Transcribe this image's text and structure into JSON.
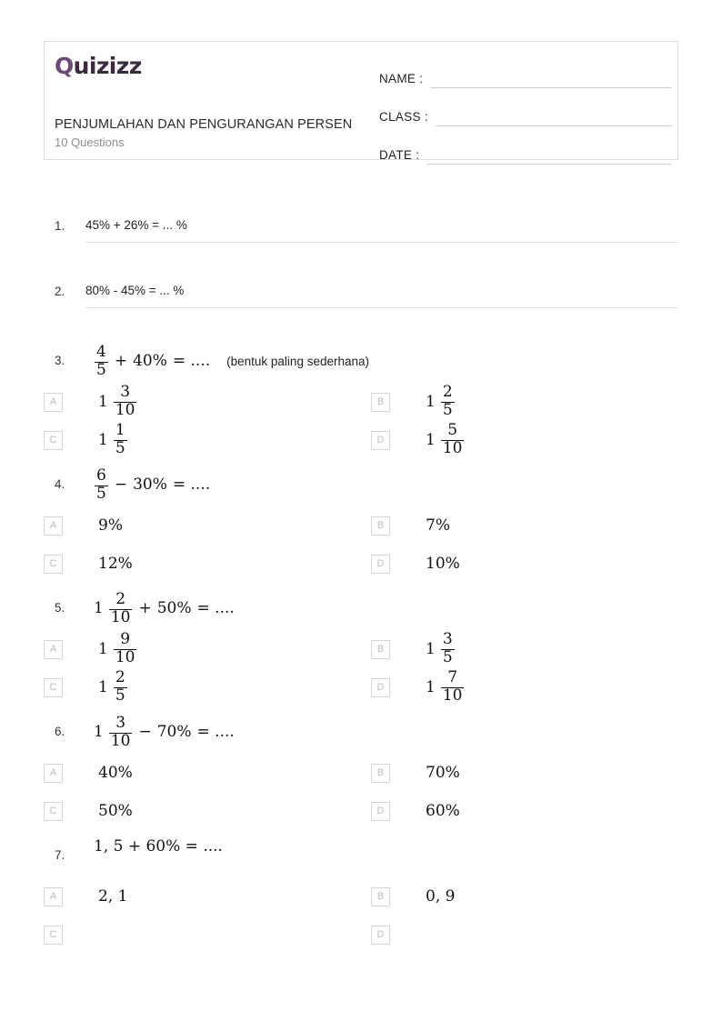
{
  "header": {
    "logo_text": "Quizizz",
    "logo_color": "#3b2a40",
    "title": "PENJUMLAHAN DAN PENGURANGAN PERSEN",
    "question_count_label": "10 Questions",
    "fields": [
      {
        "label": "NAME :",
        "value": ""
      },
      {
        "label": "CLASS :",
        "value": ""
      },
      {
        "label": "DATE :",
        "value": ""
      }
    ]
  },
  "questions": [
    {
      "number": "1.",
      "type": "short-answer",
      "text": "45% + 26% = ... %"
    },
    {
      "number": "2.",
      "type": "short-answer",
      "text": "80% - 45% = ... %"
    },
    {
      "number": "3.",
      "type": "multiple-choice",
      "stem": {
        "whole": "",
        "num": "4",
        "den": "5",
        "op": "+",
        "rhs": "40%",
        "eq": "= ....",
        "note": "(bentuk paling sederhana)"
      },
      "options": [
        {
          "letter": "A",
          "whole": "1",
          "num": "3",
          "den": "10"
        },
        {
          "letter": "B",
          "whole": "1",
          "num": "2",
          "den": "5"
        },
        {
          "letter": "C",
          "whole": "1",
          "num": "1",
          "den": "5"
        },
        {
          "letter": "D",
          "whole": "1",
          "num": "5",
          "den": "10"
        }
      ]
    },
    {
      "number": "4.",
      "type": "multiple-choice",
      "stem": {
        "whole": "",
        "num": "6",
        "den": "5",
        "op": "−",
        "rhs": "30%",
        "eq": "= ....",
        "note": ""
      },
      "options": [
        {
          "letter": "A",
          "plain": "9%"
        },
        {
          "letter": "B",
          "plain": "7%"
        },
        {
          "letter": "C",
          "plain": "12%"
        },
        {
          "letter": "D",
          "plain": "10%"
        }
      ]
    },
    {
      "number": "5.",
      "type": "multiple-choice",
      "stem": {
        "whole": "1",
        "num": "2",
        "den": "10",
        "op": "+",
        "rhs": "50%",
        "eq": "= ....",
        "note": ""
      },
      "options": [
        {
          "letter": "A",
          "whole": "1",
          "num": "9",
          "den": "10"
        },
        {
          "letter": "B",
          "whole": "1",
          "num": "3",
          "den": "5"
        },
        {
          "letter": "C",
          "whole": "1",
          "num": "2",
          "den": "5"
        },
        {
          "letter": "D",
          "whole": "1",
          "num": "7",
          "den": "10"
        }
      ]
    },
    {
      "number": "6.",
      "type": "multiple-choice",
      "stem": {
        "whole": "1",
        "num": "3",
        "den": "10",
        "op": "−",
        "rhs": "70%",
        "eq": "= ....",
        "note": ""
      },
      "options": [
        {
          "letter": "A",
          "plain": "40%"
        },
        {
          "letter": "B",
          "plain": "70%"
        },
        {
          "letter": "C",
          "plain": "50%"
        },
        {
          "letter": "D",
          "plain": "60%"
        }
      ]
    },
    {
      "number": "7.",
      "type": "multiple-choice",
      "stem_plain": "1, 5 + 60% = ....",
      "options": [
        {
          "letter": "A",
          "plain": "2, 1"
        },
        {
          "letter": "B",
          "plain": "0, 9"
        },
        {
          "letter": "C",
          "plain": ""
        },
        {
          "letter": "D",
          "plain": ""
        }
      ]
    }
  ]
}
